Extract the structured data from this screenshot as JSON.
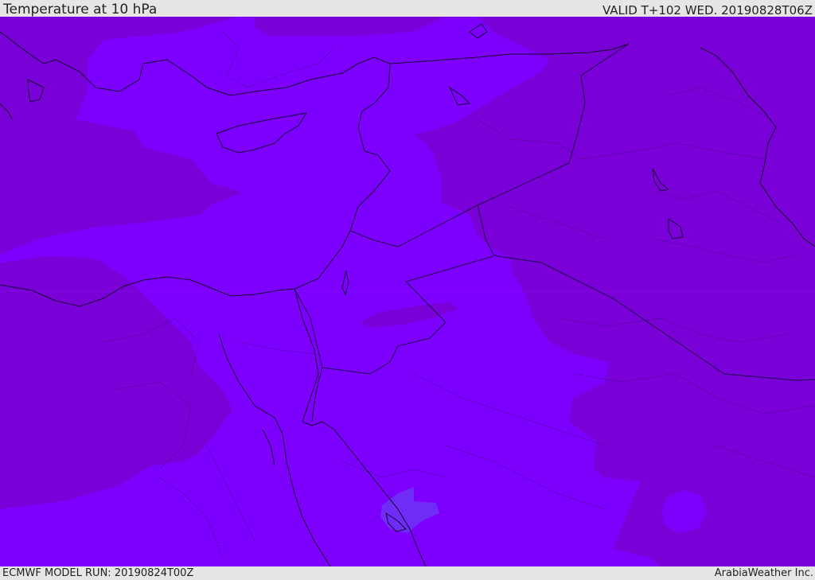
{
  "header": {
    "title": "Temperature at 10 hPa",
    "valid_time": "VALID T+102 WED. 20190828T06Z"
  },
  "footer": {
    "model_run": "ECMWF MODEL RUN: 20190824T00Z",
    "credit": "ArabiaWeather Inc."
  },
  "colors": {
    "field_base": "#7d00f0",
    "field_warm": "#7a00d8",
    "field_mid": "#7b0af5",
    "field_pocket": "#6e2cf6",
    "coastline": "#1a0a3a",
    "border": "#2a0a55",
    "header_bg": "#e6e6e6"
  }
}
